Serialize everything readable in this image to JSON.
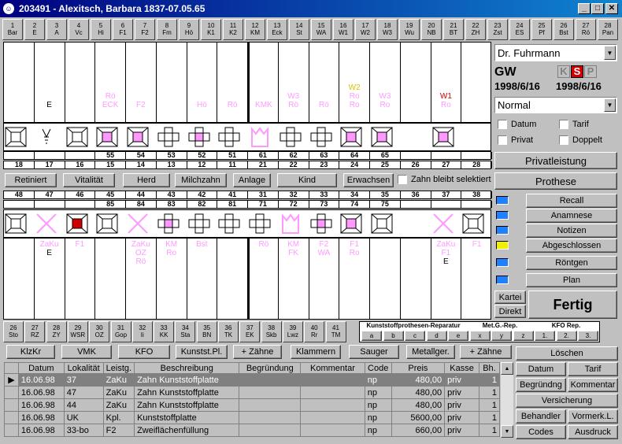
{
  "window": {
    "title": "203491  -  Alexitsch, Barbara    1837-07.05.65",
    "min": "_",
    "max": "□",
    "close": "✕"
  },
  "top_buttons": [
    [
      "1",
      "Bar"
    ],
    [
      "2",
      "E"
    ],
    [
      "3",
      "A"
    ],
    [
      "4",
      "Vc"
    ],
    [
      "5",
      "Hi"
    ],
    [
      "6",
      "F1"
    ],
    [
      "7",
      "F2"
    ],
    [
      "8",
      "Fm"
    ],
    [
      "9",
      "Hö"
    ],
    [
      "10",
      "K1"
    ],
    [
      "11",
      "K2"
    ],
    [
      "12",
      "KM"
    ],
    [
      "13",
      "Eck"
    ],
    [
      "14",
      "St"
    ],
    [
      "15",
      "WA"
    ],
    [
      "16",
      "W1"
    ],
    [
      "17",
      "W2"
    ],
    [
      "18",
      "W3"
    ],
    [
      "19",
      "Wu"
    ],
    [
      "20",
      "NB"
    ],
    [
      "21",
      "BT"
    ],
    [
      "22",
      "ZH"
    ],
    [
      "23",
      "Zst"
    ],
    [
      "24",
      "ES"
    ],
    [
      "25",
      "Pf"
    ],
    [
      "26",
      "Bst"
    ],
    [
      "27",
      "Rö"
    ],
    [
      "28",
      "Pan"
    ]
  ],
  "bottom_buttons": [
    [
      "26",
      "Sto"
    ],
    [
      "27",
      "RZ"
    ],
    [
      "28",
      "ZY"
    ],
    [
      "29",
      "WSR"
    ],
    [
      "30",
      "OZ"
    ],
    [
      "31",
      "Gop"
    ],
    [
      "32",
      "Ii"
    ],
    [
      "33",
      "KK"
    ],
    [
      "34",
      "Sta"
    ],
    [
      "35",
      "BN"
    ],
    [
      "36",
      "TK"
    ],
    [
      "37",
      "EK"
    ],
    [
      "38",
      "Skb"
    ],
    [
      "39",
      "Lwz"
    ],
    [
      "40",
      "Rr"
    ],
    [
      "41",
      "TM"
    ]
  ],
  "repair_labels": {
    "kunst": "Kunststoffprothesen-Reparatur",
    "metg": "Met.G.-Rep.",
    "kfo": "KFO Rep."
  },
  "repair_cells": [
    "a",
    "b",
    "c",
    "d",
    "e",
    "x",
    "y",
    "z",
    "1.",
    "2.",
    "3."
  ],
  "upper_marks": [
    [],
    [
      "E"
    ],
    [],
    [],
    [
      "Rö",
      "ECK"
    ],
    [
      "F2"
    ],
    [],
    [
      "Hö"
    ],
    [
      "Rö"
    ],
    [],
    [
      "KMK"
    ],
    [
      "W3",
      "Rö"
    ],
    [
      "Rö"
    ],
    [
      "W2",
      "Ro",
      "Ro"
    ],
    [
      "W3",
      "Ro"
    ],
    [],
    [
      "W1",
      "Ro"
    ],
    []
  ],
  "upper_row1": [
    "",
    "",
    "",
    "55",
    "54",
    "53",
    "52",
    "51",
    "61",
    "62",
    "63",
    "64",
    "65",
    "",
    "",
    ""
  ],
  "upper_row2": [
    "18",
    "17",
    "16",
    "15",
    "14",
    "13",
    "12",
    "11",
    "21",
    "22",
    "23",
    "24",
    "25",
    "26",
    "27",
    "28"
  ],
  "lower_row1": [
    "48",
    "47",
    "46",
    "45",
    "44",
    "43",
    "42",
    "41",
    "31",
    "32",
    "33",
    "34",
    "35",
    "36",
    "37",
    "38"
  ],
  "lower_row2": [
    "",
    "",
    "",
    "85",
    "84",
    "83",
    "82",
    "81",
    "71",
    "72",
    "73",
    "74",
    "75",
    "",
    "",
    ""
  ],
  "lower_marks": [
    [],
    [
      "ZaKu",
      "E"
    ],
    [
      "F1"
    ],
    [],
    [
      "ZaKu",
      "OZ",
      "Rö"
    ],
    [
      "KM",
      "Ro"
    ],
    [
      "Bst"
    ],
    [],
    [
      "Rö"
    ],
    [
      "KM",
      "FK"
    ],
    [
      "F2",
      "WA"
    ],
    [
      "F1",
      "Ro"
    ],
    [],
    [],
    [
      "ZaKu",
      "F1",
      "E"
    ],
    [
      "F1"
    ]
  ],
  "mid_buttons": [
    "Retiniert",
    "Vitalität",
    "Herd",
    "Milchzahn",
    "Anlage",
    "Kind",
    "Erwachsen"
  ],
  "zahn_checkbox": "Zahn bleibt selektiert",
  "doctor": "Dr. Fuhrmann",
  "gw": "GW",
  "ksp": [
    "K",
    "S",
    "P"
  ],
  "date_left": "1998/6/16",
  "date_right": "1998/6/16",
  "mode": "Normal",
  "checks": {
    "datum": "Datum",
    "tarif": "Tarif",
    "privat": "Privat",
    "doppelt": "Doppelt"
  },
  "privatleistung": "Privatleistung",
  "prothese": "Prothese",
  "nav": [
    "Recall",
    "Anamnese",
    "Notizen",
    "Abgeschlossen",
    "Röntgen",
    "Plan"
  ],
  "kartei": "Kartei",
  "direkt": "Direkt",
  "fertig": "Fertig",
  "tool_buttons": [
    "KlzKr",
    "VMK",
    "KFO",
    "Kunstst.Pl.",
    "+ Zähne",
    "Klammern",
    "Sauger",
    "Metallger.",
    "+ Zähne"
  ],
  "loeschen": "Löschen",
  "right_grid": [
    "Datum",
    "Tarif",
    "Begründng",
    "Kommentar",
    "Versicherung",
    "Behandler",
    "Vormerk.L.",
    "Codes",
    "Ausdruck"
  ],
  "table": {
    "headers": [
      "Datum",
      "Lokalität",
      "Leistg.",
      "Beschreibung",
      "Begründung",
      "Kommentar",
      "Code",
      "Preis",
      "Kasse",
      "Bh."
    ],
    "rows": [
      [
        "16.06.98",
        "37",
        "ZaKu",
        "Zahn Kunststoffplatte",
        "",
        "",
        "np",
        "480,00",
        "priv",
        "1"
      ],
      [
        "16.06.98",
        "47",
        "ZaKu",
        "Zahn Kunststoffplatte",
        "",
        "",
        "np",
        "480,00",
        "priv",
        "1"
      ],
      [
        "16.06.98",
        "44",
        "ZaKu",
        "Zahn Kunststoffplatte",
        "",
        "",
        "np",
        "480,00",
        "priv",
        "1"
      ],
      [
        "16.06.98",
        "UK",
        "Kpl.",
        "Kunststoffplatte",
        "",
        "",
        "np",
        "5600,00",
        "priv",
        "1"
      ],
      [
        "16.06.98",
        "33-bo",
        "F2",
        "Zweiflächenfüllung",
        "",
        "",
        "np",
        "660,00",
        "priv",
        "1"
      ]
    ]
  },
  "colors": {
    "pink": "#ff99ff",
    "red": "#d00000",
    "yellow": "#d8c000",
    "blue": "#2080ff",
    "navy": "#000080"
  }
}
